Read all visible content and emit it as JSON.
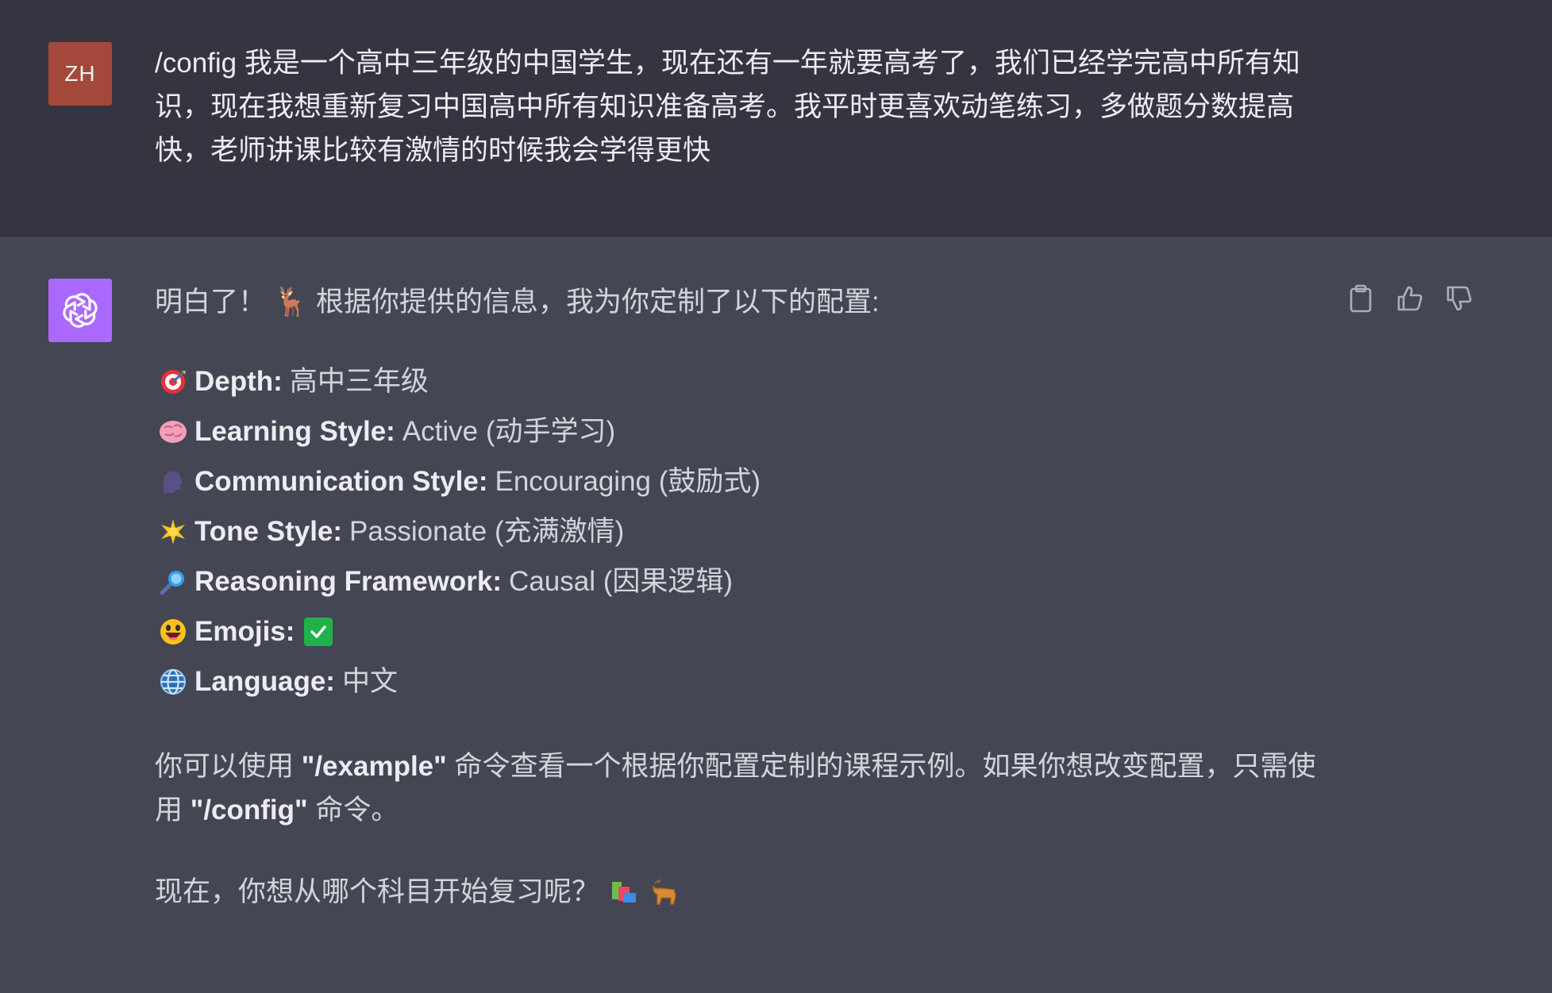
{
  "user": {
    "avatar_initials": "ZH",
    "avatar_color": "#a3483a",
    "message": "/config 我是一个高中三年级的中国学生，现在还有一年就要高考了，我们已经学完高中所有知识，现在我想重新复习中国高中所有知识准备高考。我平时更喜欢动笔练习，多做题分数提高快，老师讲课比较有激情的时候我会学得更快"
  },
  "assistant": {
    "avatar_color": "#ab68ff",
    "intro": "明白了！ 🦌 根据你提供的信息，我为你定制了以下的配置:",
    "config_items": [
      {
        "icon": "target-icon",
        "label": "Depth:",
        "value": "高中三年级"
      },
      {
        "icon": "brain-icon",
        "label": "Learning Style:",
        "value": "Active (动手学习)"
      },
      {
        "icon": "speaking-head-icon",
        "label": "Communication Style:",
        "value": "Encouraging (鼓励式)"
      },
      {
        "icon": "star-icon",
        "label": "Tone Style:",
        "value": "Passionate (充满激情)"
      },
      {
        "icon": "magnifier-icon",
        "label": "Reasoning Framework:",
        "value": "Causal (因果逻辑)"
      },
      {
        "icon": "smiley-icon",
        "label": "Emojis:",
        "value": ""
      },
      {
        "icon": "globe-icon",
        "label": "Language:",
        "value": "中文"
      }
    ],
    "para_prefix": "你可以使用 ",
    "para_cmd1": "\"/example\"",
    "para_mid": " 命令查看一个根据你配置定制的课程示例。如果你想改变配置，只需使用 ",
    "para_cmd2": "\"/config\"",
    "para_suffix": " 命令。",
    "closing": "现在，你想从哪个科目开始复习呢？"
  },
  "actions": {
    "copy": "clipboard-icon",
    "up": "thumbs-up-icon",
    "down": "thumbs-down-icon"
  }
}
